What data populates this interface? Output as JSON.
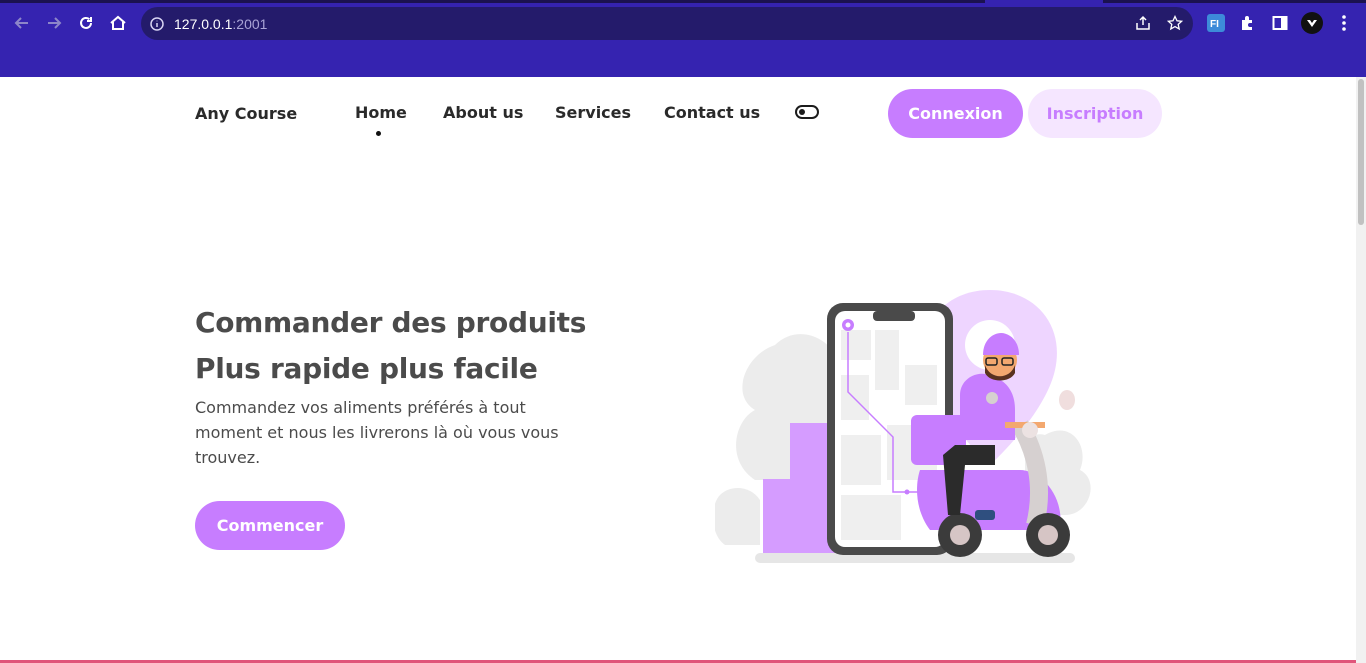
{
  "browser": {
    "url_host": "127.0.0.1",
    "url_port": ":2001",
    "icons": [
      "back-arrow-icon",
      "forward-arrow-icon",
      "reload-icon",
      "home-icon",
      "info-icon",
      "share-icon",
      "star-icon",
      "extension-fi-icon",
      "puzzle-icon",
      "side-panel-icon",
      "profile-avatar-icon",
      "menu-dots-icon"
    ],
    "extension_label": "FI"
  },
  "navbar": {
    "brand": "Any Course",
    "links": [
      "Home",
      "About us",
      "Services",
      "Contact us"
    ],
    "active_link": "Home",
    "login_label": "Connexion",
    "signup_label": "Inscription"
  },
  "hero": {
    "title_line1": "Commander des produits",
    "title_line2": "Plus rapide plus facile",
    "description": "Commandez vos aliments préférés à tout moment et nous les livrerons là où vous vous trouvez.",
    "cta_label": "Commencer"
  },
  "colors": {
    "browser_frame": "#3523b0",
    "accent": "#c77dff",
    "accent_light": "#f5e6ff",
    "text": "#4b4b4b"
  }
}
